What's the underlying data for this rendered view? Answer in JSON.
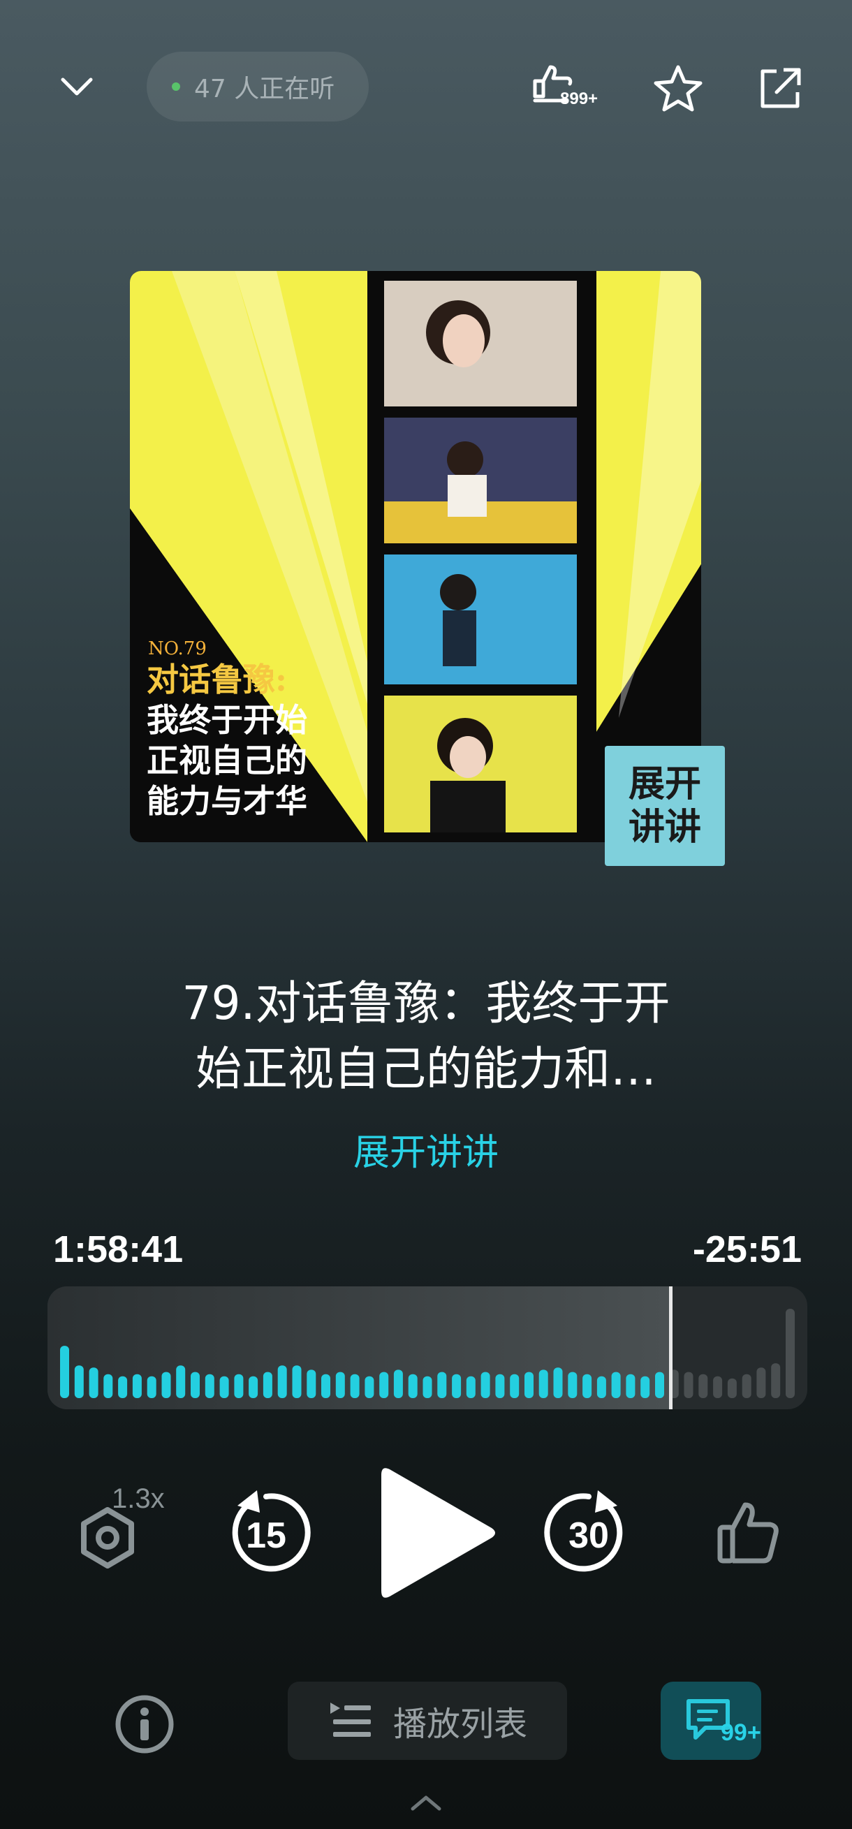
{
  "header": {
    "listeners_text": "47 人正在听",
    "like_count_badge": "899+"
  },
  "cover": {
    "episode_number": "NO.79",
    "headline_lines": [
      "对话鲁豫:",
      "我终于开始",
      "正视自己的",
      "能力与才华"
    ],
    "brand_stamp_lines": [
      "展开",
      "讲讲"
    ]
  },
  "episode": {
    "title_line1": "79.对话鲁豫：我终于开",
    "title_line2": "始正视自己的能力和…",
    "podcast_name": "展开讲讲"
  },
  "player": {
    "elapsed": "1:58:41",
    "remaining": "-25:51",
    "progress_fraction": 0.82,
    "speed_label": "1.3x",
    "rewind_seconds": "15",
    "forward_seconds": "30",
    "waveform_levels": [
      0.48,
      0.3,
      0.28,
      0.22,
      0.2,
      0.22,
      0.2,
      0.24,
      0.3,
      0.24,
      0.22,
      0.2,
      0.22,
      0.2,
      0.24,
      0.3,
      0.3,
      0.26,
      0.22,
      0.24,
      0.22,
      0.2,
      0.24,
      0.26,
      0.22,
      0.2,
      0.24,
      0.22,
      0.2,
      0.24,
      0.22,
      0.22,
      0.24,
      0.26,
      0.28,
      0.24,
      0.22,
      0.2,
      0.24,
      0.22,
      0.2,
      0.24,
      0.26,
      0.24,
      0.22,
      0.2,
      0.18,
      0.22,
      0.28,
      0.32,
      0.82
    ],
    "accent_color": "#24cfe0"
  },
  "bottom": {
    "playlist_label": "播放列表",
    "comments_badge": "99+"
  }
}
